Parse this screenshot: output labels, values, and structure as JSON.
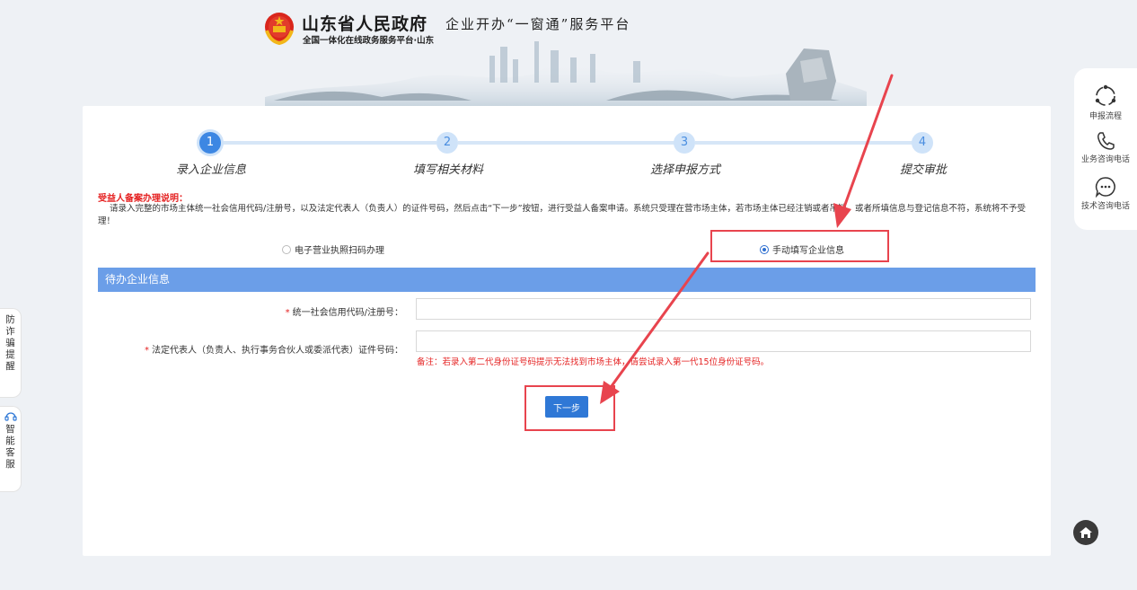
{
  "header": {
    "gov_name": "山东省人民政府",
    "gov_sub": "全国一体化在线政务服务平台·山东",
    "platform_title": "企业开办“一窗通”服务平台"
  },
  "steps": [
    {
      "num": "1",
      "label": "录入企业信息",
      "active": true
    },
    {
      "num": "2",
      "label": "填写相关材料",
      "active": false
    },
    {
      "num": "3",
      "label": "选择申报方式",
      "active": false
    },
    {
      "num": "4",
      "label": "提交审批",
      "active": false
    }
  ],
  "notice": {
    "title": "受益人备案办理说明：",
    "body": "请录入完整的市场主体统一社会信用代码/注册号，以及法定代表人（负责人）的证件号码，然后点击“下一步”按钮，进行受益人备案申请。系统只受理在营市场主体，若市场主体已经注销或者吊销，或者所填信息与登记信息不符，系统将不予受理！"
  },
  "options": {
    "scan_label": "电子营业执照扫码办理",
    "manual_label": "手动填写企业信息",
    "selected": "manual"
  },
  "section": {
    "title": "待办企业信息"
  },
  "form": {
    "credit_code_label": "统一社会信用代码/注册号：",
    "credit_code_value": "",
    "id_label": "法定代表人（负责人、执行事务合伙人或委派代表）证件号码：",
    "id_value": "",
    "required_mark": "*",
    "note": "备注：若录入第二代身份证号码提示无法找到市场主体，请尝试录入第一代15位身份证号码。",
    "next_label": "下一步"
  },
  "right_float": {
    "process": "申报流程",
    "business_phone": "业务咨询电话",
    "tech_phone": "技术咨询电话"
  },
  "left_float": {
    "anti_fraud": "防诈骗提醒",
    "smart_service": "智能客服"
  },
  "colors": {
    "accent": "#3d87e3",
    "section_bar": "#6b9ee8",
    "required": "#e52222",
    "annotation": "#e8444e"
  }
}
